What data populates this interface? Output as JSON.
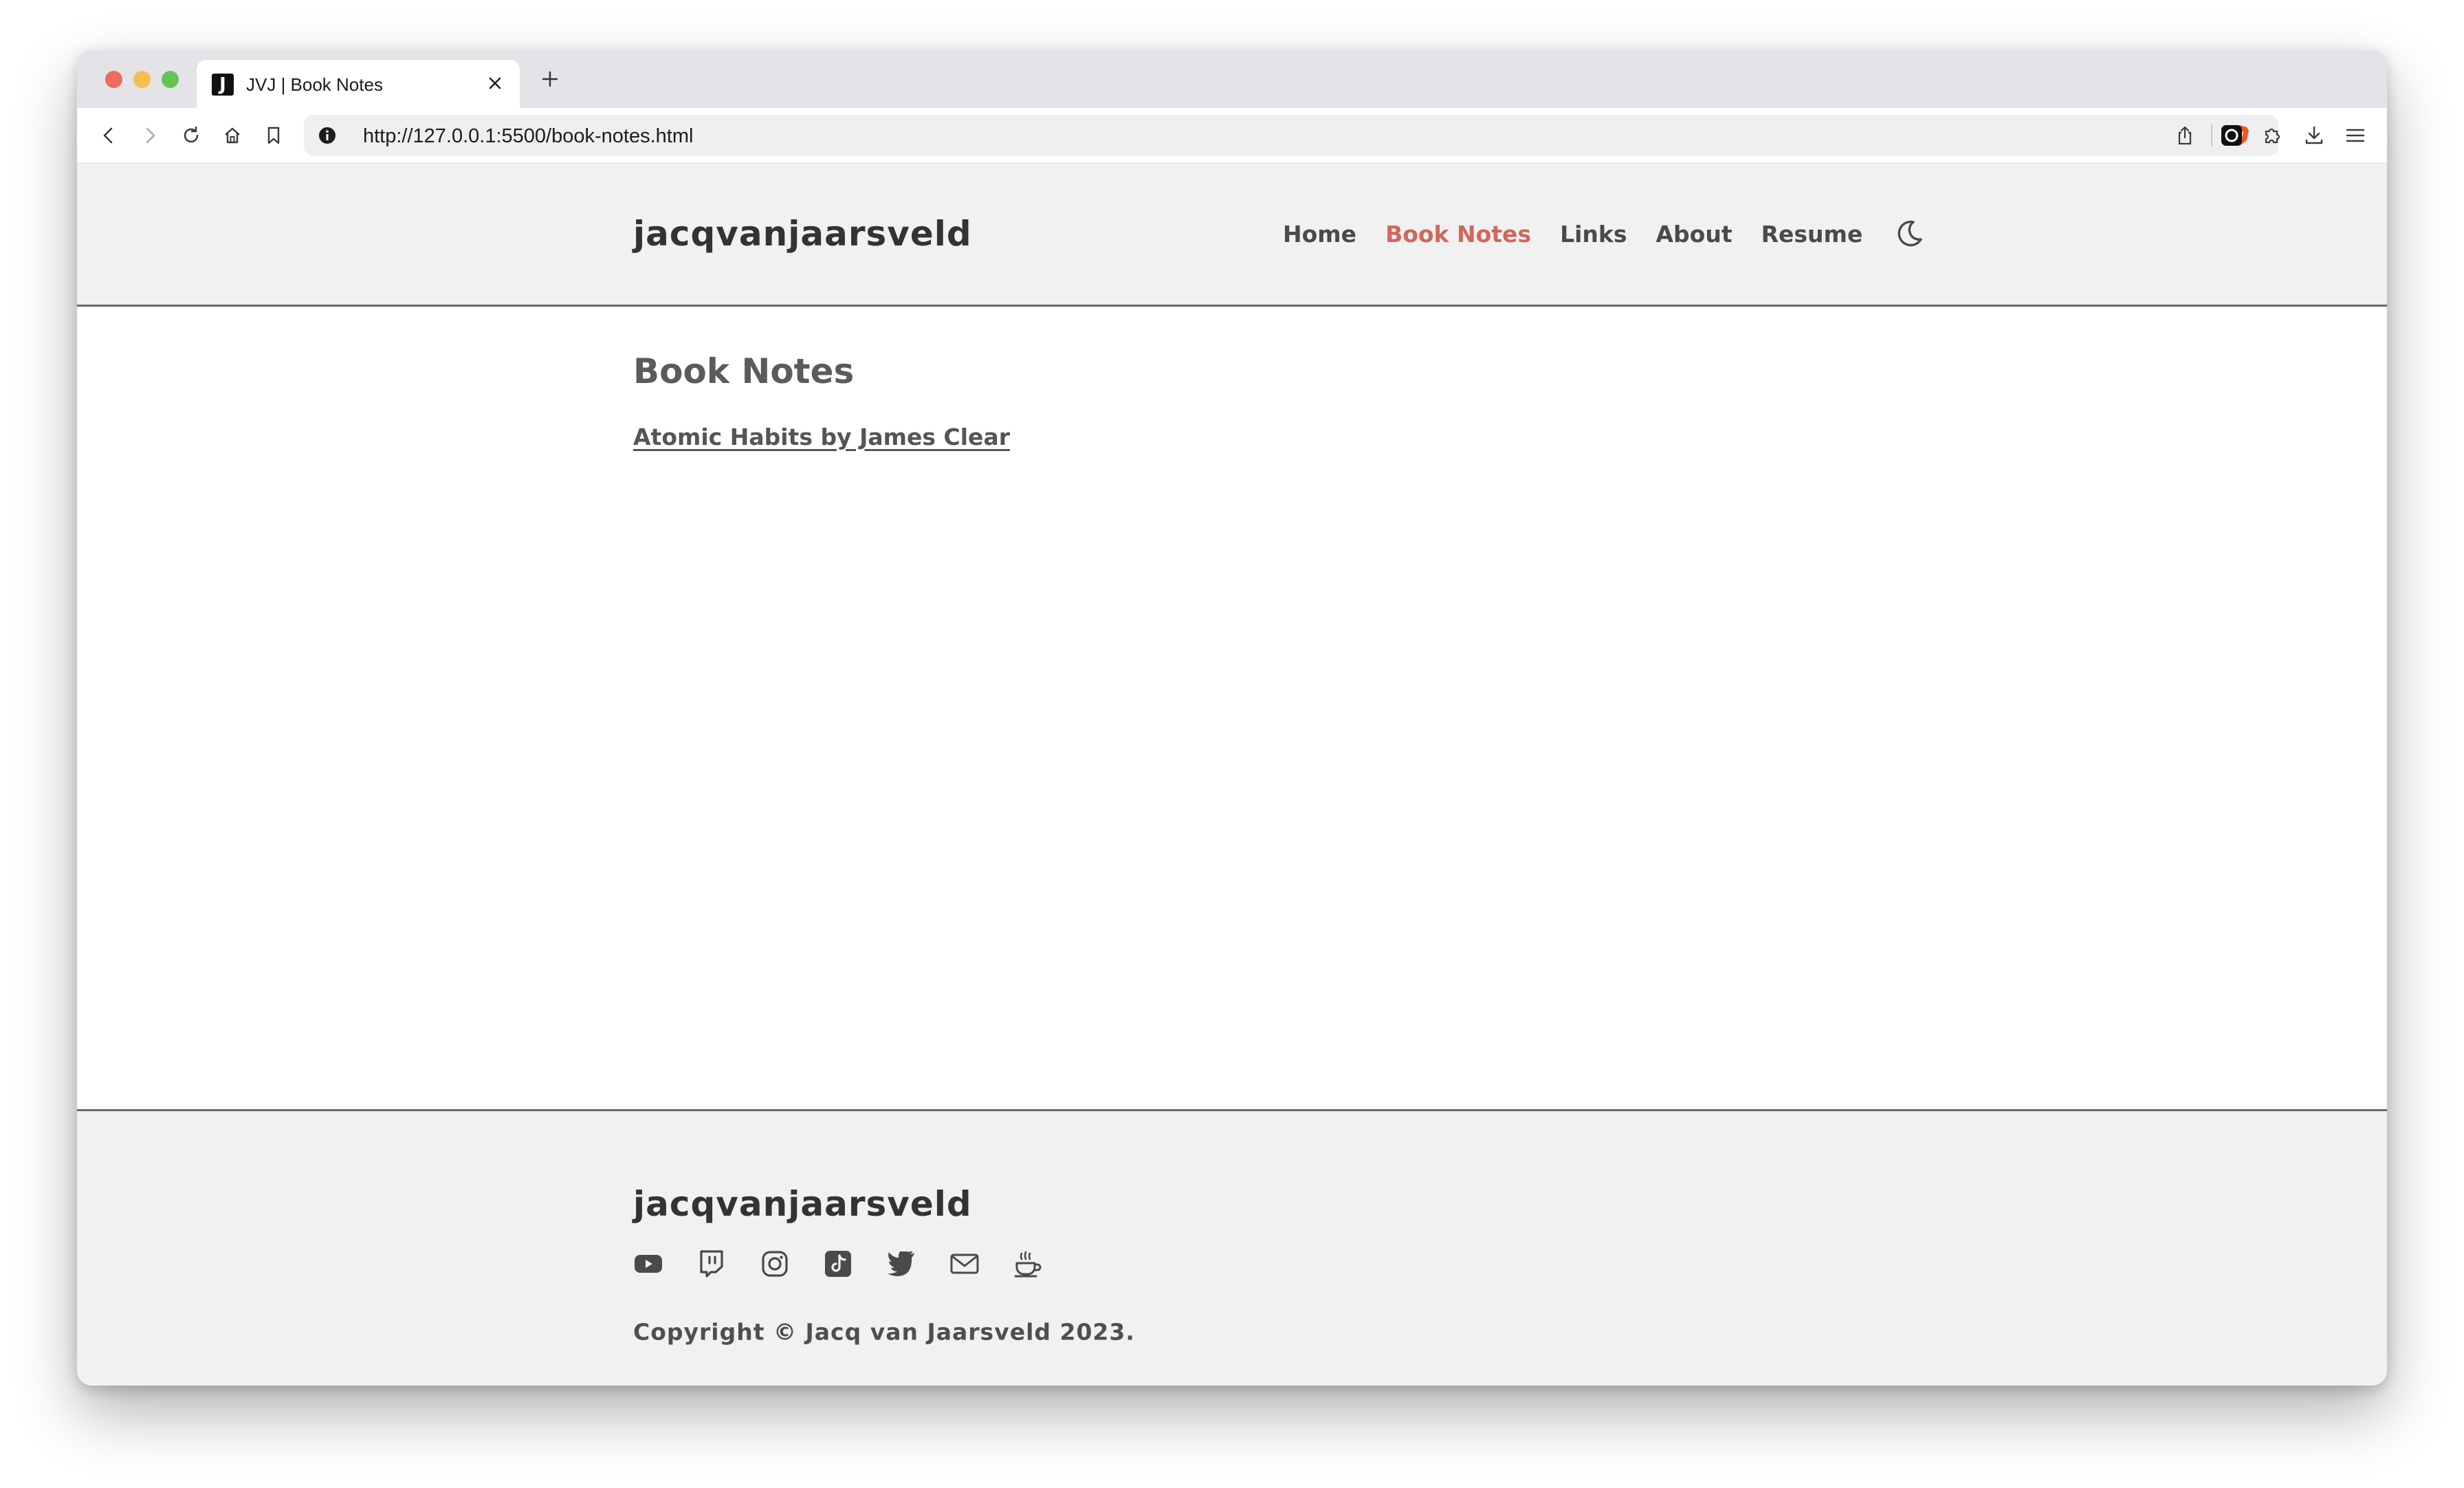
{
  "browser": {
    "tab_title": "JVJ | Book Notes",
    "tab_favicon_letter": "J",
    "url": "http://127.0.0.1:5500/book-notes.html"
  },
  "header": {
    "brand": "jacqvanjaarsveld",
    "nav": [
      {
        "label": "Home",
        "active": false
      },
      {
        "label": "Book Notes",
        "active": true
      },
      {
        "label": "Links",
        "active": false
      },
      {
        "label": "About",
        "active": false
      },
      {
        "label": "Resume",
        "active": false
      }
    ],
    "theme_icon": "moon-icon"
  },
  "main": {
    "title": "Book Notes",
    "books": [
      {
        "label": "Atomic Habits by James Clear"
      }
    ]
  },
  "footer": {
    "brand": "jacqvanjaarsveld",
    "social_icons": [
      "youtube-icon",
      "twitch-icon",
      "instagram-icon",
      "tiktok-icon",
      "twitter-icon",
      "mail-icon",
      "coffee-icon"
    ],
    "copyright": "Copyright © Jacq van Jaarsveld 2023."
  },
  "colors": {
    "accent": "#d0675c",
    "text": "#4a4a4a",
    "band": "#f1f1f1",
    "rule": "#6a6a6a"
  }
}
